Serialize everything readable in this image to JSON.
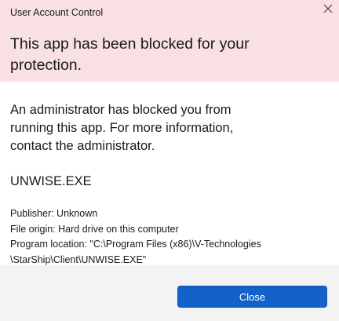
{
  "window": {
    "title": "User Account Control"
  },
  "header": {
    "headline": "This app has been blocked for your protection.",
    "background_color": "#f9e0e3"
  },
  "body": {
    "message": "An administrator has blocked you from running this app. For more information, contact the administrator.",
    "app_name": "UNWISE.EXE",
    "publisher": "Publisher: Unknown",
    "file_origin": "File origin: Hard drive on this computer",
    "program_location_line1": "Program location: \"C:\\Program Files (x86)\\V-Technologies",
    "program_location_line2": "\\StarShip\\Client\\UNWISE.EXE\""
  },
  "footer": {
    "close_label": "Close",
    "accent_color": "#1262c9"
  },
  "icons": {
    "close": "close-icon"
  }
}
